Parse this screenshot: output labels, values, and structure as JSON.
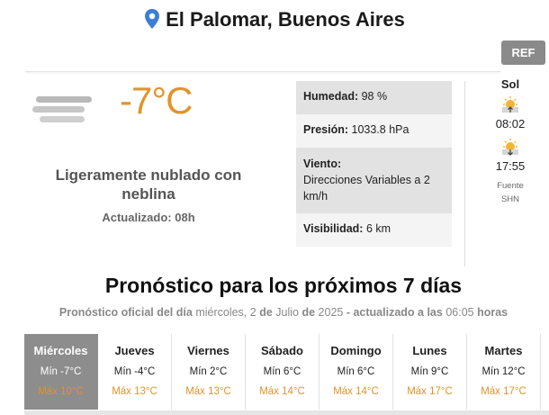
{
  "header": {
    "location": "El Palomar, Buenos Aires",
    "pin_icon": "map-pin-icon",
    "accent_color": "#3b7fd4",
    "ref_label": "REF"
  },
  "current": {
    "icon": "fog-clouds-icon",
    "temperature": "-7°C",
    "condition": "Ligeramente nublado con neblina",
    "updated": "Actualizado: 08h",
    "temp_color": "#e0942a"
  },
  "details": {
    "humidity_label": "Humedad:",
    "humidity_value": "98 %",
    "pressure_label": "Presión:",
    "pressure_value": "1033.8 hPa",
    "wind_label": "Viento:",
    "wind_value": "Direcciones Variables a 2 km/h",
    "visibility_label": "Visibilidad:",
    "visibility_value": "6 km"
  },
  "sun": {
    "title": "Sol",
    "sunrise_icon": "sunrise-icon",
    "sunrise": "08:02",
    "sunset_icon": "sunset-icon",
    "sunset": "17:55",
    "source_label": "Fuente",
    "source": "SHN"
  },
  "forecast": {
    "title": "Pronóstico para los próximos 7 días",
    "subtitle_part1": "Pronóstico oficial del día",
    "subtitle_part2": "miércoles, 2",
    "subtitle_part3": "de",
    "subtitle_part4": "Julio",
    "subtitle_part5": "de",
    "subtitle_part6": "2025",
    "subtitle_part7": "- actualizado a las",
    "subtitle_part8": "06:05",
    "subtitle_part9": "horas",
    "days": [
      {
        "name": "Miércoles",
        "min": "Mín -7°C",
        "max": "Máx 10°C"
      },
      {
        "name": "Jueves",
        "min": "Mín -4°C",
        "max": "Máx 13°C"
      },
      {
        "name": "Viernes",
        "min": "Mín 2°C",
        "max": "Máx 13°C"
      },
      {
        "name": "Sábado",
        "min": "Mín 6°C",
        "max": "Máx 14°C"
      },
      {
        "name": "Domingo",
        "min": "Mín 6°C",
        "max": "Máx 14°C"
      },
      {
        "name": "Lunes",
        "min": "Mín 9°C",
        "max": "Máx 17°C"
      },
      {
        "name": "Martes",
        "min": "Mín 12°C",
        "max": "Máx 17°C"
      }
    ]
  }
}
